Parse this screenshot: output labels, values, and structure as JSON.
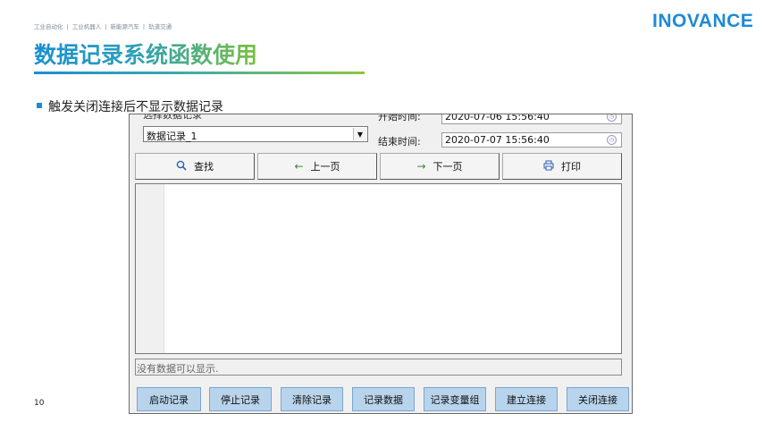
{
  "header": {
    "tagline": [
      "工业自动化",
      "|",
      "工业机器人",
      "|",
      "新能源汽车",
      "|",
      "轨道交通"
    ],
    "title": "数据记录系统函数使用",
    "logo": "INOVANCE"
  },
  "bullet": "触发关闭连接后不显示数据记录",
  "page_number": "10",
  "app": {
    "record_select_label": "选择数据记录",
    "record_select_value": "数据记录_1",
    "start_time_label": "开始时间:",
    "start_time_value": "2020-07-06 15:56:40",
    "end_time_label": "结束时间:",
    "end_time_value": "2020-07-07 15:56:40",
    "nav_buttons": [
      {
        "label": "查找",
        "icon": "search-icon"
      },
      {
        "label": "上一页",
        "icon": "arrow-left-icon"
      },
      {
        "label": "下一页",
        "icon": "arrow-right-icon"
      },
      {
        "label": "打印",
        "icon": "printer-icon"
      }
    ],
    "status_text": "没有数据可以显示.",
    "action_buttons": [
      "启动记录",
      "停止记录",
      "清除记录",
      "记录数据",
      "记录变量组",
      "建立连接",
      "关闭连接"
    ]
  },
  "colors": {
    "brand_blue": "#1d8ad6",
    "brand_green": "#8cc63f",
    "action_button": "#b8d4ec"
  }
}
